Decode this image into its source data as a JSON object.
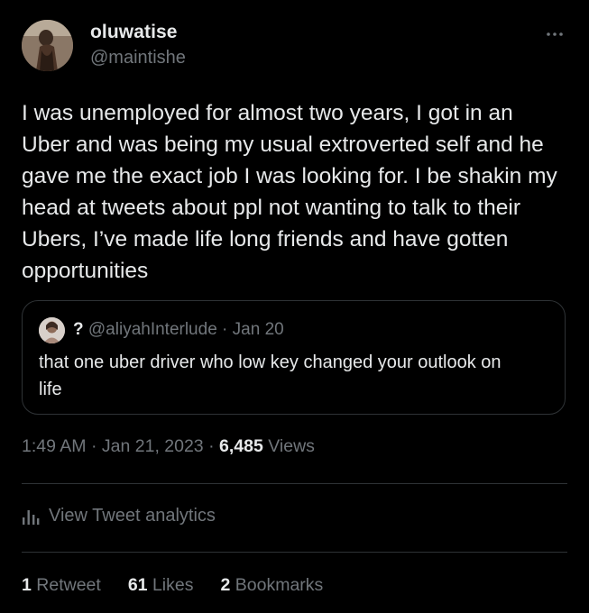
{
  "author": {
    "display_name": "oluwatise",
    "handle": "@maintishe"
  },
  "tweet": {
    "lines": [
      "I was unemployed for almost two years, I got in an",
      "Uber and was being my usual extroverted self and he",
      "gave me the exact job I was looking for. I be shakin my",
      "head at tweets about ppl not wanting to talk to their",
      "Ubers, I’ve made life long friends and have gotten",
      "opportunities"
    ]
  },
  "quoted": {
    "name": "?",
    "handle": "@aliyahInterlude",
    "separator": "·",
    "date": "Jan 20",
    "lines": [
      "that one uber driver who low key changed your outlook on",
      "life"
    ]
  },
  "meta": {
    "time": "1:49 AM",
    "sep1": "·",
    "date": "Jan 21, 2023",
    "sep2": "·",
    "views_count": "6,485",
    "views_label": "Views"
  },
  "analytics": {
    "label": "View Tweet analytics"
  },
  "stats": {
    "retweets_count": "1",
    "retweets_label": "Retweet",
    "likes_count": "61",
    "likes_label": "Likes",
    "bookmarks_count": "2",
    "bookmarks_label": "Bookmarks"
  },
  "colors": {
    "background": "#000000",
    "text_primary": "#e7e9ea",
    "text_secondary": "#71767b",
    "border": "#2f3336"
  }
}
